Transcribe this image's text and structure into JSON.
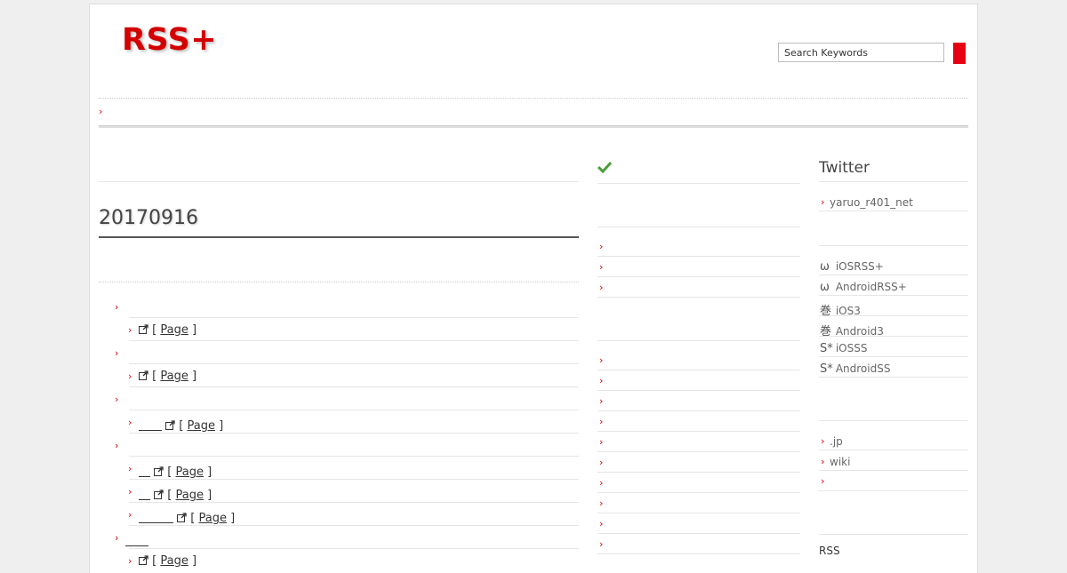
{
  "header": {
    "logo": "RSS+",
    "search": {
      "placeholder": "Search Keywords",
      "value": "Search Keywords"
    }
  },
  "breadcrumb": {
    "chevron": "›"
  },
  "main": {
    "date": "20170916",
    "groups": [
      {
        "title": "",
        "items": [
          {
            "title": "",
            "page_label": "Page"
          }
        ]
      },
      {
        "title": "",
        "items": [
          {
            "title": "",
            "page_label": "Page"
          }
        ]
      },
      {
        "title": "",
        "items": [
          {
            "title": "　　",
            "page_label": "Page"
          }
        ]
      },
      {
        "title": "",
        "items": [
          {
            "title": "　",
            "page_label": "Page"
          },
          {
            "title": "　",
            "page_label": "Page"
          },
          {
            "title": "　　　",
            "page_label": "Page"
          }
        ]
      },
      {
        "title": "　　",
        "items": [
          {
            "title": "",
            "page_label": "Page"
          }
        ]
      }
    ]
  },
  "middle_column": {
    "check_icon": "check-icon"
  },
  "sidebar": {
    "twitter": {
      "title": "Twitter",
      "account": "yaruo_r401_net"
    },
    "apps": [
      {
        "icon": "ω",
        "label": "iOSRSS+"
      },
      {
        "icon": "ω",
        "label": "AndroidRSS+"
      },
      {
        "icon": "巻",
        "label": "iOS3"
      },
      {
        "icon": "巻",
        "label": "Android3"
      },
      {
        "icon": "S*",
        "label": "iOSSS"
      },
      {
        "icon": "S*",
        "label": "AndroidSS"
      }
    ],
    "links": [
      ".jp",
      "wiki",
      ""
    ],
    "rss_label": "RSS"
  },
  "colors": {
    "brand_red": "#d40000",
    "search_button": "#e60012",
    "check_green": "#4a9e3a"
  }
}
